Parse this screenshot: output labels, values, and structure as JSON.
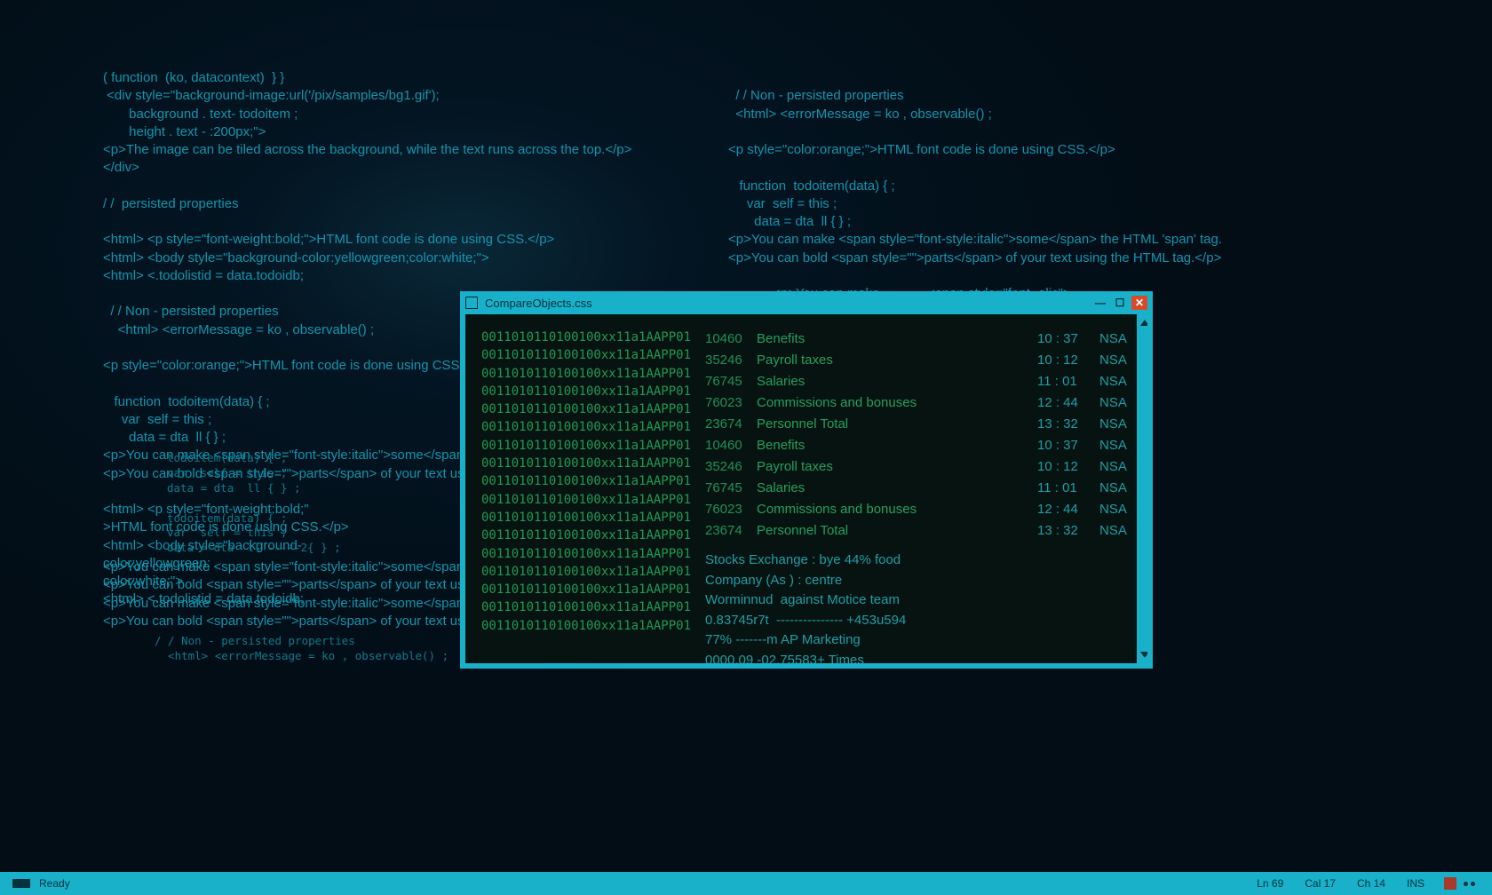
{
  "bg": {
    "left1": "( function  (ko, datacontext)  } }\n <div style=\"background-image:url('/pix/samples/bg1.gif');\n       background . text- todoitem ;\n       height . text - :200px;\">\n<p>The image can be tiled across the background, while the text runs across the top.</p>\n</div>\n\n/ /  persisted properties\n\n<html> <p style=\"font-weight:bold;\">HTML font code is done using CSS.</p>\n<html> <body style=\"background-color:yellowgreen;color:white;\">\n<html> <.todolistid = data.todoidb;\n\n  / / Non - persisted properties\n    <html> <errorMessage = ko , observable() ;\n\n<p style=\"color:orange;\">HTML font code is done using CSS.</p>\n\n   function  todoitem(data) { ;\n     var  self = this ;\n       data = dta  ll { } ;\n<p>You can make <span style=\"font-style:italic\">some</span> the H\n<p>You can bold <span style=\"\">parts</span> of your text using the\n\n<html> <p style=\"font-weight:bold;\"\n>HTML font code is done using CSS.</p>\n<html> <body style=\"background-\ncolor:yellowgreen;\ncolor:white;\">\n<html> <.todolistid = data.todoidb;",
    "small1": "todoitem(data) { ;\nvar  self = this ;\ndata = dta  ll { } ;\n\ntodoitem(data) { ;\nvar  self = this ;\ndata = dta  ll -----2{ } ;",
    "left2": "<p>You can make <span style=\"font-style:italic\">some</span> the HTML 'span'\n<p>You can bold <span style=\"\">parts</span> of your text using the HTML tag.<\n<p>You can make <span style=\"font-style:italic\">some</span> the HTML 'span'\n<p>You can bold <span style=\"\">parts</span> of your text using the HTML tag.<",
    "small2": "/ / Non - persisted properties\n  <html> <errorMessage = ko , observable() ;",
    "right1": "/ / Non - persisted properties\n  <html> <errorMessage = ko , observable() ;\n\n<p style=\"color:orange;\">HTML font code is done using CSS.</p>\n\n   function  todoitem(data) { ;\n     var  self = this ;\n       data = dta  ll { } ;\n<p>You can make <span style=\"font-style:italic\">some</span> the HTML 'span' tag.\n<p>You can bold <span style=\"\">parts</span> of your text using the HTML tag.</p>\n\n            <p>You can make---------- <span style=\"font- alic\">\n            <p>You can make---------- <span style=\"font- alic\">\n            <p>You can make---------- <span style=\"font- alic\">\n            <p>You can make---------- <span style=\"font- alic\">\n            <p>You can make---------- <span style=\"font- alic\">",
    "right1_small": "todoitem(data) { ;\nvar  self = this ;\ndata = dta  ll -----2{ } ;"
  },
  "window": {
    "title": "CompareObjects.css",
    "close": "✕",
    "left_rows": [
      {
        "bin": "0011010110100100",
        "xid": "xx11a1",
        "app": "AAPP01"
      },
      {
        "bin": "0011010110100100",
        "xid": "xx11a1",
        "app": "AAPP01"
      },
      {
        "bin": "0011010110100100",
        "xid": "xx11a1",
        "app": "AAPP01"
      },
      {
        "bin": "0011010110100100",
        "xid": "xx11a1",
        "app": "AAPP01"
      },
      {
        "bin": "0011010110100100",
        "xid": "xx11a1",
        "app": "AAPP01"
      },
      {
        "bin": "0011010110100100",
        "xid": "xx11a1",
        "app": "AAPP01"
      },
      {
        "bin": "0011010110100100",
        "xid": "xx11a1",
        "app": "AAPP01"
      },
      {
        "bin": "0011010110100100",
        "xid": "xx11a1",
        "app": "AAPP01"
      },
      {
        "bin": "0011010110100100",
        "xid": "xx11a1",
        "app": "AAPP01"
      },
      {
        "bin": "0011010110100100",
        "xid": "xx11a1",
        "app": "AAPP01"
      },
      {
        "bin": "0011010110100100",
        "xid": "xx11a1",
        "app": "AAPP01"
      },
      {
        "bin": "0011010110100100",
        "xid": "xx11a1",
        "app": "AAPP01"
      },
      {
        "bin": "0011010110100100",
        "xid": "xx11a1",
        "app": "AAPP01"
      },
      {
        "bin": "0011010110100100",
        "xid": "xx11a1",
        "app": "AAPP01"
      },
      {
        "bin": "0011010110100100",
        "xid": "xx11a1",
        "app": "AAPP01"
      },
      {
        "bin": "0011010110100100",
        "xid": "xx11a1",
        "app": "AAPP01"
      },
      {
        "bin": "0011010110100100",
        "xid": "xx11a1",
        "app": "AAPP01"
      }
    ],
    "right_rows": [
      {
        "num": "10460",
        "name": "Benefits",
        "time": "10 : 37",
        "nsa": "NSA"
      },
      {
        "num": "35246",
        "name": "Payroll taxes",
        "time": "10 : 12",
        "nsa": "NSA"
      },
      {
        "num": "76745",
        "name": "Salaries",
        "time": "11 : 01",
        "nsa": "NSA"
      },
      {
        "num": "76023",
        "name": "Commissions and bonuses",
        "time": "12 : 44",
        "nsa": "NSA"
      },
      {
        "num": "23674",
        "name": "Personnel Total",
        "time": "13 : 32",
        "nsa": "NSA"
      },
      {
        "num": "10460",
        "name": "Benefits",
        "time": "10 : 37",
        "nsa": "NSA"
      },
      {
        "num": "35246",
        "name": "Payroll taxes",
        "time": "10 : 12",
        "nsa": "NSA"
      },
      {
        "num": "76745",
        "name": "Salaries",
        "time": "11 : 01",
        "nsa": "NSA"
      },
      {
        "num": "76023",
        "name": "Commissions and bonuses",
        "time": "12 : 44",
        "nsa": "NSA"
      },
      {
        "num": "23674",
        "name": "Personnel Total",
        "time": "13 : 32",
        "nsa": "NSA"
      }
    ],
    "footer": "Stocks Exchange : bye 44% food\nCompany (As ) : centre\nWorminnud  against Motice team\n0.83745r7t  --------------- +453u594\n77% -------m AP Marketing\n0000.09 -02,75583+ Times"
  },
  "status": {
    "ready": "Ready",
    "ln": "Ln 69",
    "cal": "Cal 17",
    "ch": "Ch 14",
    "ins": "INS"
  }
}
